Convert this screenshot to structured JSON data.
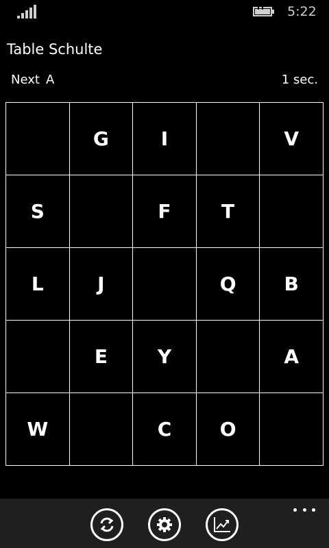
{
  "status_bar": {
    "time": "5:22",
    "signal_icon": "signal-strength-icon",
    "battery_icon": "battery-charging-icon"
  },
  "app": {
    "title": "Table Schulte"
  },
  "info": {
    "next_label": "Next",
    "next_value": "A",
    "timer": "1 sec."
  },
  "grid": {
    "cells": [
      "",
      "G",
      "I",
      "",
      "V",
      "S",
      "",
      "F",
      "T",
      "",
      "L",
      "J",
      "",
      "Q",
      "B",
      "",
      "E",
      "Y",
      "",
      "A",
      "W",
      "",
      "C",
      "O",
      ""
    ]
  },
  "app_bar": {
    "buttons": [
      {
        "icon": "refresh-icon"
      },
      {
        "icon": "settings-icon"
      },
      {
        "icon": "statistics-chart-icon"
      }
    ],
    "more_icon": "more-ellipsis-icon"
  },
  "colors": {
    "background": "#000000",
    "foreground": "#ffffff",
    "app_bar": "#1f1f1f"
  }
}
